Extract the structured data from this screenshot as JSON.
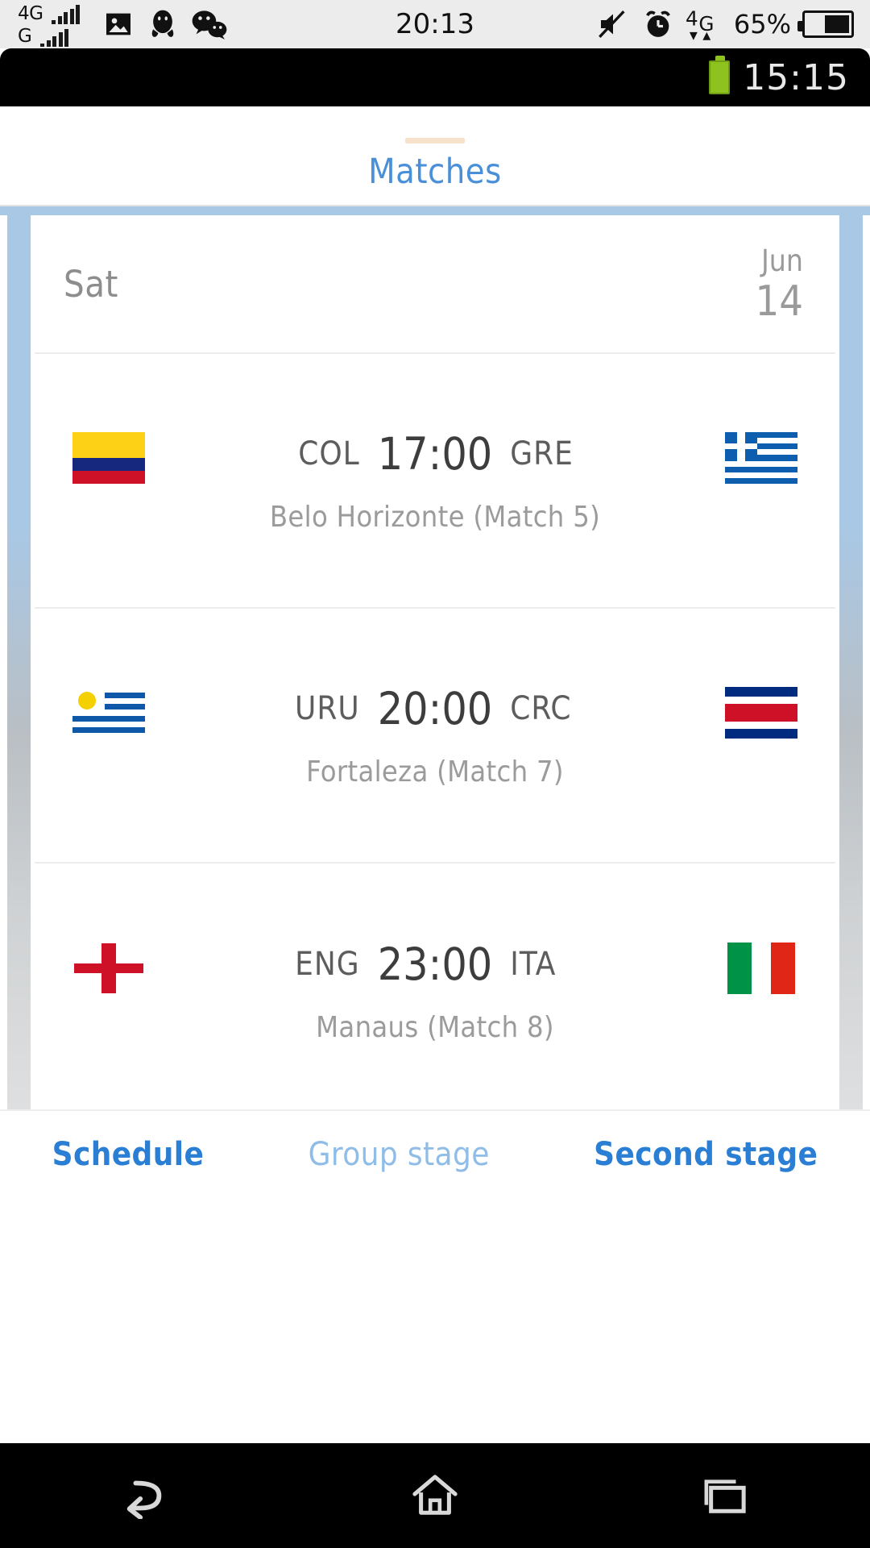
{
  "os_status": {
    "network_primary": "4G",
    "network_secondary": "G",
    "clock": "20:13",
    "battery_percent": "65%",
    "icons": [
      "gallery-icon",
      "qq-icon",
      "wechat-icon",
      "mute-icon",
      "alarm-icon",
      "data-4g-icon",
      "battery-icon"
    ]
  },
  "screenshot": {
    "status": {
      "clock": "15:15"
    },
    "header": {
      "title": "Matches"
    },
    "date_header": {
      "day": "Sat",
      "month": "Jun",
      "date": "14"
    },
    "matches": [
      {
        "home_code": "COL",
        "away_code": "GRE",
        "time": "17:00",
        "venue": "Belo Horizonte (Match  5)",
        "home_flag": "colombia-flag",
        "away_flag": "greece-flag"
      },
      {
        "home_code": "URU",
        "away_code": "CRC",
        "time": "20:00",
        "venue": "Fortaleza (Match  7)",
        "home_flag": "uruguay-flag",
        "away_flag": "costa-rica-flag"
      },
      {
        "home_code": "ENG",
        "away_code": "ITA",
        "time": "23:00",
        "venue": "Manaus (Match  8)",
        "home_flag": "england-flag",
        "away_flag": "italy-flag"
      }
    ],
    "tabs": [
      {
        "label": "Schedule",
        "state": "active"
      },
      {
        "label": "Group stage",
        "state": "inactive"
      },
      {
        "label": "Second stage",
        "state": "link"
      }
    ]
  },
  "nav": {
    "back": "back-icon",
    "home": "home-icon",
    "recents": "recents-icon"
  },
  "colors": {
    "accent_blue": "#2a7fd4",
    "title_blue": "#4a90d9",
    "frame_blue": "#a8c8e6",
    "dot_blue": "#1e8fe8"
  }
}
